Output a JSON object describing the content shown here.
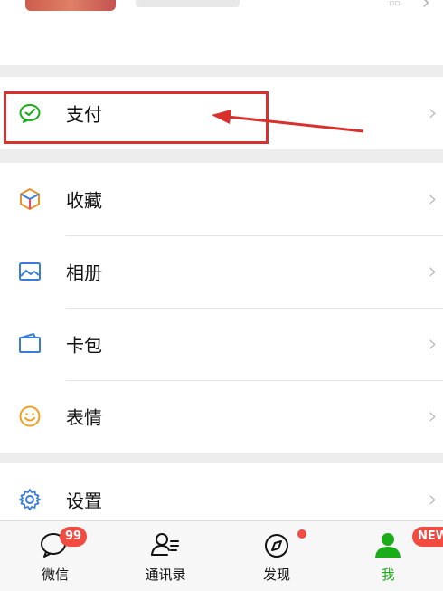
{
  "colors": {
    "accent_green": "#1aad19",
    "highlight_red": "#d8312d",
    "badge_red": "#f24b40"
  },
  "menu": {
    "pay": {
      "label": "支付",
      "icon": "wechat-pay-icon"
    },
    "items": [
      {
        "label": "收藏",
        "icon": "cube-icon"
      },
      {
        "label": "相册",
        "icon": "image-icon"
      },
      {
        "label": "卡包",
        "icon": "wallet-icon"
      },
      {
        "label": "表情",
        "icon": "smiley-icon"
      }
    ],
    "settings": {
      "label": "设置",
      "icon": "gear-icon"
    }
  },
  "tabbar": {
    "tabs": [
      {
        "label": "微信",
        "icon": "chat-bubble-icon",
        "badge": "99"
      },
      {
        "label": "通讯录",
        "icon": "contacts-icon"
      },
      {
        "label": "发现",
        "icon": "compass-icon",
        "dot": true
      },
      {
        "label": "我",
        "icon": "person-icon",
        "badge": "NEW",
        "active": true
      }
    ]
  }
}
